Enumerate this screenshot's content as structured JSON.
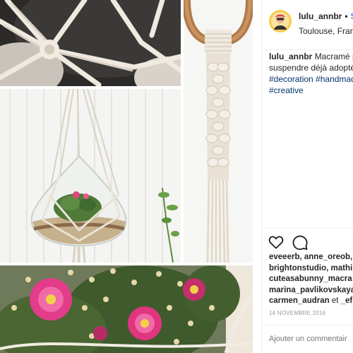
{
  "post": {
    "username": "lulu_annbr",
    "follow_label": "S",
    "location": "Toulouse, Fran",
    "caption": {
      "user": "lulu_annbr",
      "line1": "Macramé p",
      "line2": "suspendre déjà adopté",
      "tags_line1": "#decoration #handmad",
      "tags_line2": "#creative"
    },
    "likes": {
      "line1": "eveeerb, anne_oreob,",
      "line2": "brightonstudio, mathi",
      "line3": "cuteasabunny_macra",
      "line4": "marina_pavlikovskaya",
      "line5_a": "carmen_audran",
      "line5_b": " et ",
      "line5_c": "_ef"
    },
    "date": "14 NOVEMBRE 2016",
    "comment_placeholder": "Ajouter un commentair"
  },
  "icons": [
    "heart-icon",
    "comment-icon"
  ],
  "colors": {
    "link": "#3897f0",
    "hashtag": "#003569",
    "muted": "#999999",
    "border": "#efefef"
  }
}
